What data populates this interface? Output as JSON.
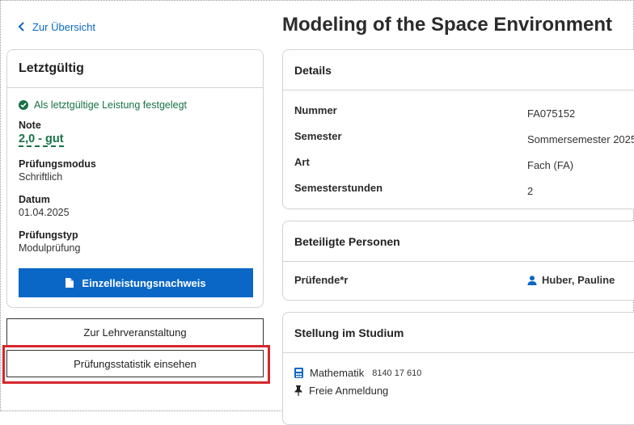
{
  "nav": {
    "back_label": "Zur Übersicht"
  },
  "left_card": {
    "title": "Letztgültig",
    "status": "Als letztgültige Leistung festgelegt",
    "fields": [
      {
        "label": "Note",
        "value": "2,0 - gut"
      },
      {
        "label": "Prüfungsmodus",
        "value": "Schriftlich"
      },
      {
        "label": "Datum",
        "value": "01.04.2025"
      },
      {
        "label": "Prüfungstyp",
        "value": "Modulprüfung"
      }
    ],
    "certificate_button": "Einzelleistungsnachweis"
  },
  "actions": {
    "course_button": "Zur Lehrveranstaltung",
    "statistics_button": "Prüfungsstatistik einsehen"
  },
  "title": "Modeling of the Space Environment",
  "details": {
    "heading": "Details",
    "rows": [
      {
        "label": "Nummer",
        "value": "FA075152"
      },
      {
        "label": "Semester",
        "value": "Sommersemester 2025"
      },
      {
        "label": "Art",
        "value": "Fach (FA)"
      },
      {
        "label": "Semesterstunden",
        "value": "2"
      }
    ]
  },
  "persons": {
    "heading": "Beteiligte Personen",
    "role": "Prüfende*r",
    "name": "Huber, Pauline"
  },
  "study": {
    "heading": "Stellung im Studium",
    "program": "Mathematik",
    "program_code": "8140 17 610",
    "registration": "Freie Anmeldung"
  },
  "colors": {
    "accent": "#0a67c6",
    "success": "#177245",
    "highlight": "#d6262e"
  },
  "icons": [
    "chevron-left-icon",
    "check-circle-icon",
    "document-icon",
    "person-icon",
    "calculator-icon",
    "pin-icon"
  ]
}
